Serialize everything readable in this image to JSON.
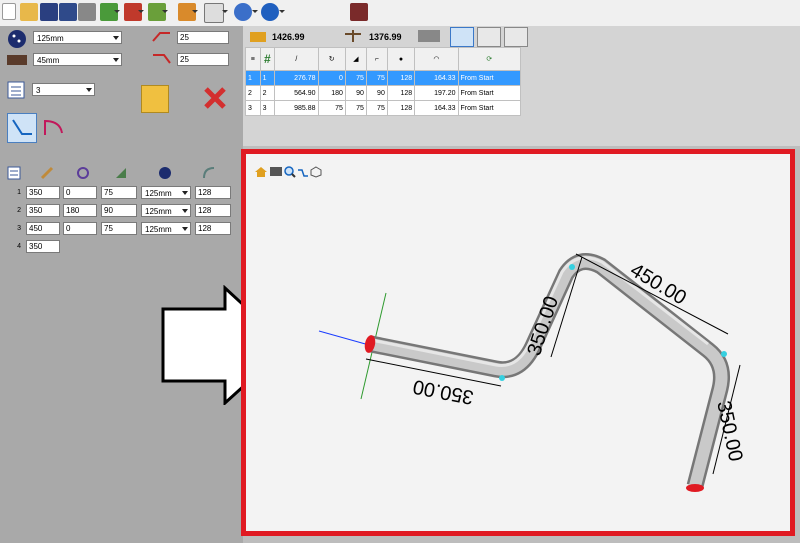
{
  "left": {
    "bend_die_select": "125mm",
    "material_select": "45mm",
    "param1": "25",
    "param2": "25",
    "count_select": "3"
  },
  "segments": [
    {
      "index": "1",
      "length": "350",
      "rotation": "0",
      "angle": "75",
      "die": "125mm",
      "radius": "128"
    },
    {
      "index": "2",
      "length": "350",
      "rotation": "180",
      "angle": "90",
      "die": "125mm",
      "radius": "128"
    },
    {
      "index": "3",
      "length": "450",
      "rotation": "0",
      "angle": "75",
      "die": "125mm",
      "radius": "128"
    },
    {
      "index": "4",
      "length": "350"
    }
  ],
  "summary": {
    "total": "1426.99",
    "weight": "1376.99"
  },
  "grid_rows": [
    {
      "c0": "1",
      "c1": "1",
      "c2": "276.78",
      "c3": "0",
      "c4": "75",
      "c5": "75",
      "c6": "128",
      "c7": "164.33",
      "c8": "From Start"
    },
    {
      "c0": "2",
      "c1": "2",
      "c2": "564.90",
      "c3": "180",
      "c4": "90",
      "c5": "90",
      "c6": "128",
      "c7": "197.20",
      "c8": "From Start"
    },
    {
      "c0": "3",
      "c1": "3",
      "c2": "985.88",
      "c3": "75",
      "c4": "75",
      "c5": "75",
      "c6": "128",
      "c7": "164.33",
      "c8": "From Start"
    }
  ],
  "viewport": {
    "dims": [
      "350.00",
      "350.00",
      "450.00",
      "350.00"
    ]
  },
  "icons": {
    "arrow": "large-right-arrow-annotation",
    "accent": "#e01a22"
  }
}
